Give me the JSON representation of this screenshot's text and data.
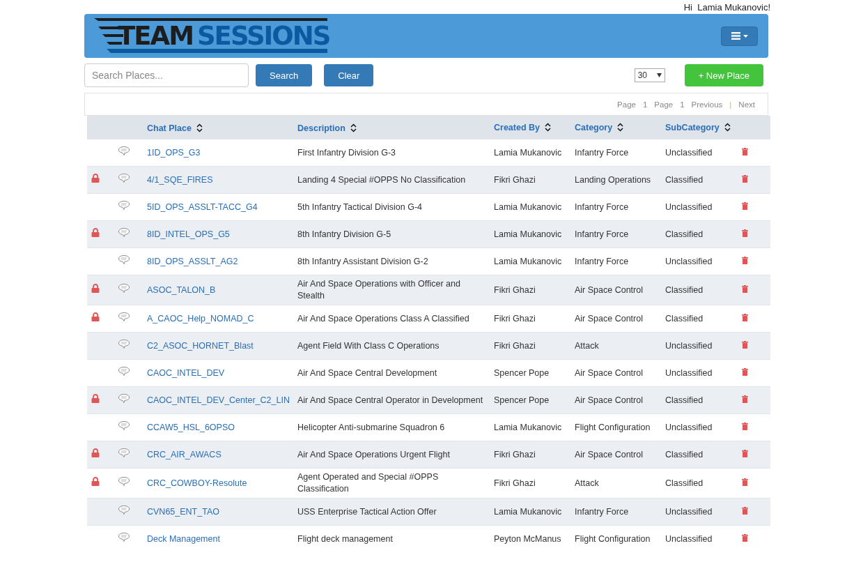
{
  "greeting": "Hi  Lamia Mukanovic!",
  "logo": {
    "word_1": "TEAM",
    "word_2": "SESSIONS"
  },
  "search": {
    "placeholder": "Search Places..."
  },
  "buttons": {
    "search": "Search",
    "clear": "Clear",
    "new_place": "+ New Place"
  },
  "page_size": "30",
  "pagination": {
    "page_label_1": "Page",
    "page_1": "1",
    "page_label_2": "Page",
    "page_2": "1",
    "previous": "Previous",
    "separator": "|",
    "next": "Next"
  },
  "table": {
    "columns": [
      "Chat Place",
      "Description",
      "Created By",
      "Category",
      "SubCategory"
    ],
    "rows": [
      {
        "locked": false,
        "place": "1ID_OPS_G3",
        "description": "First Infantry Division G-3",
        "created_by": "Lamia Mukanovic",
        "category": "Infantry Force",
        "subcategory": "Unclassified"
      },
      {
        "locked": true,
        "place": "4/1_SQE_FIRES",
        "description": "Landing 4 Special #OPPS No Classification",
        "created_by": "Fikri Ghazi",
        "category": "Landing Operations",
        "subcategory": "Classified"
      },
      {
        "locked": false,
        "place": "5ID_OPS_ASSLT-TACC_G4",
        "description": "5th Infantry Tactical Division G-4",
        "created_by": "Lamia Mukanovic",
        "category": "Infantry Force",
        "subcategory": "Unclassified"
      },
      {
        "locked": true,
        "place": "8ID_INTEL_OPS_G5",
        "description": "8th Infantry Division G-5",
        "created_by": "Lamia Mukanovic",
        "category": "Infantry Force",
        "subcategory": "Classified"
      },
      {
        "locked": false,
        "place": "8ID_OPS_ASSLT_AG2",
        "description": "8th Infantry Assistant Division G-2",
        "created_by": "Lamia Mukanovic",
        "category": "Infantry Force",
        "subcategory": "Unclassified"
      },
      {
        "locked": true,
        "place": "ASOC_TALON_B",
        "description": "Air And Space Operations with Officer and Stealth",
        "created_by": "Fikri Ghazi",
        "category": "Air Space Control",
        "subcategory": "Classified"
      },
      {
        "locked": true,
        "place": "A_CAOC_Help_NOMAD_C",
        "description": "Air And Space Operations Class A Classified",
        "created_by": "Fikri Ghazi",
        "category": "Air Space Control",
        "subcategory": "Classified"
      },
      {
        "locked": false,
        "place": "C2_ASOC_HORNET_Blast",
        "description": "Agent Field With Class C Operations",
        "created_by": "Fikri Ghazi",
        "category": "Attack",
        "subcategory": "Unclassified"
      },
      {
        "locked": false,
        "place": "CAOC_INTEL_DEV",
        "description": "Air And Space Central Development",
        "created_by": "Spencer Pope",
        "category": "Air Space Control",
        "subcategory": "Unclassified"
      },
      {
        "locked": true,
        "place": "CAOC_INTEL_DEV_Center_C2_LIN",
        "description": "Air And Space Central Operator in Development",
        "created_by": "Spencer Pope",
        "category": "Air Space Control",
        "subcategory": "Classified"
      },
      {
        "locked": false,
        "place": "CCAW5_HSL_6OPSO",
        "description": "Helicopter Anti-submarine Squadron 6",
        "created_by": "Lamia Mukanovic",
        "category": "Flight Configuration",
        "subcategory": "Unclassified"
      },
      {
        "locked": true,
        "place": "CRC_AIR_AWACS",
        "description": "Air And Space Operations Urgent Flight",
        "created_by": "Fikri Ghazi",
        "category": "Air Space Control",
        "subcategory": "Classified"
      },
      {
        "locked": true,
        "place": "CRC_COWBOY-Resolute",
        "description": "Agent Operated and Special #OPPS Classification",
        "created_by": "Fikri Ghazi",
        "category": "Attack",
        "subcategory": "Classified"
      },
      {
        "locked": false,
        "place": "CVN65_ENT_TAO",
        "description": "USS Enterprise Tactical Action Offer",
        "created_by": "Lamia Mukanovic",
        "category": "Infantry Force",
        "subcategory": "Unclassified"
      },
      {
        "locked": false,
        "place": "Deck Management",
        "description": "Flight deck management",
        "created_by": "Peyton McManus",
        "category": "Flight Configuration",
        "subcategory": "Unclassified"
      }
    ]
  }
}
